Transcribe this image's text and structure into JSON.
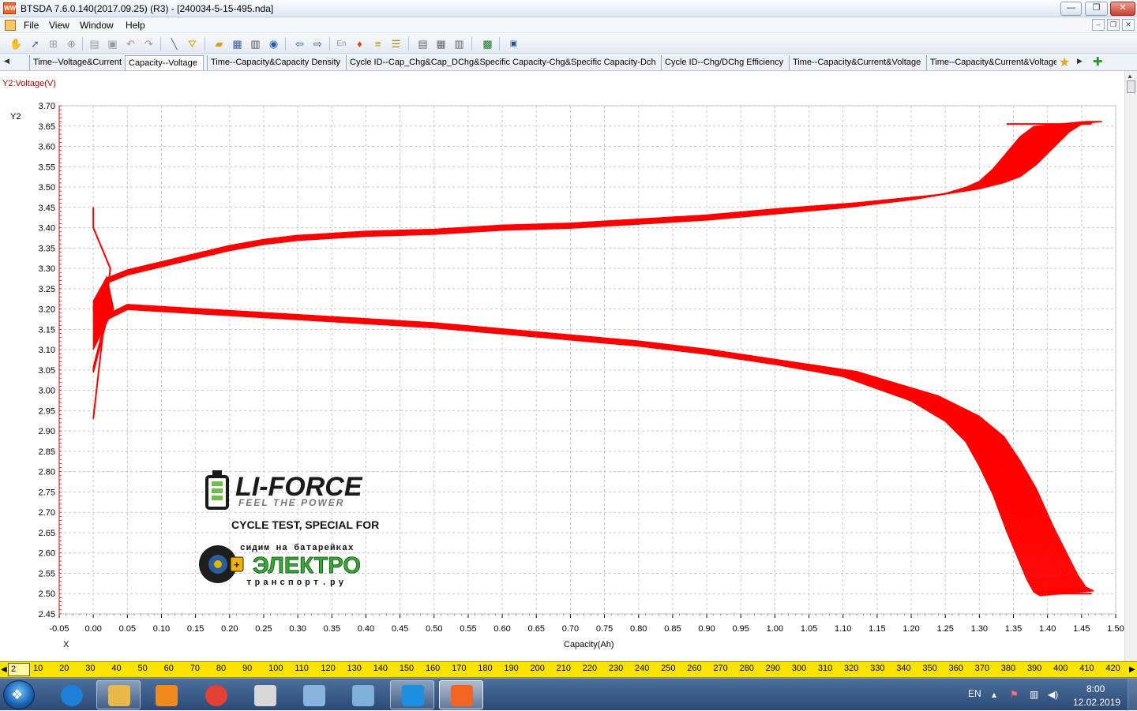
{
  "window": {
    "title": "BTSDA 7.6.0.140(2017.09.25) (R3) - [240034-5-15-495.nda]",
    "app_icon_label": "WW",
    "min_label": "—",
    "max_label": "❐",
    "close_label": "✕"
  },
  "menu": [
    "File",
    "View",
    "Window",
    "Help"
  ],
  "mdi": {
    "min": "–",
    "restore": "❐",
    "close": "✕"
  },
  "tabs": [
    {
      "label": "Time--Voltage&Current",
      "active": false
    },
    {
      "label": "Capacity--Voltage",
      "active": true
    },
    {
      "label": "Time--Capacity&Capacity Density",
      "active": false
    },
    {
      "label": "Cycle ID--Cap_Chg&Cap_DChg&Specific Capacity-Chg&Specific Capacity-Dchg",
      "active": false
    },
    {
      "label": "Cycle ID--Chg/DChg Efficiency",
      "active": false
    },
    {
      "label": "Time--Capacity&Current&Voltage",
      "active": false
    },
    {
      "label": "Time--Capacity&Current&Voltage",
      "active": false
    }
  ],
  "chart_data": {
    "type": "line",
    "y2_series_label": "Y2:Voltage(V)",
    "ylabel": "Y2",
    "xaxis_marker": "X",
    "xlabel": "Capacity(Ah)",
    "xlim": [
      -0.05,
      1.5
    ],
    "ylim": [
      2.45,
      3.7
    ],
    "x_ticks": [
      -0.05,
      0.0,
      0.05,
      0.1,
      0.15,
      0.2,
      0.25,
      0.3,
      0.35,
      0.4,
      0.45,
      0.5,
      0.55,
      0.6,
      0.65,
      0.7,
      0.75,
      0.8,
      0.85,
      0.9,
      0.95,
      1.0,
      1.05,
      1.1,
      1.15,
      1.2,
      1.25,
      1.3,
      1.35,
      1.4,
      1.45,
      1.5
    ],
    "y_ticks": [
      2.45,
      2.5,
      2.55,
      2.6,
      2.65,
      2.7,
      2.75,
      2.8,
      2.85,
      2.9,
      2.95,
      3.0,
      3.05,
      3.1,
      3.15,
      3.2,
      3.25,
      3.3,
      3.35,
      3.4,
      3.45,
      3.5,
      3.55,
      3.6,
      3.65,
      3.7
    ],
    "grid": true,
    "series_color": "#ff0000",
    "charge_curve": {
      "x": [
        0.0,
        0.02,
        0.05,
        0.1,
        0.15,
        0.2,
        0.25,
        0.3,
        0.4,
        0.5,
        0.6,
        0.7,
        0.8,
        0.9,
        1.0,
        1.1,
        1.2,
        1.25,
        1.28,
        1.3,
        1.32,
        1.34,
        1.36,
        1.38,
        1.4
      ],
      "y": [
        3.2,
        3.27,
        3.29,
        3.31,
        3.33,
        3.35,
        3.365,
        3.375,
        3.385,
        3.39,
        3.4,
        3.405,
        3.415,
        3.425,
        3.44,
        3.455,
        3.475,
        3.49,
        3.505,
        3.52,
        3.55,
        3.59,
        3.63,
        3.655,
        3.655
      ],
      "x_spread": 0.08
    },
    "discharge_curve": {
      "x": [
        0.0,
        0.02,
        0.05,
        0.1,
        0.2,
        0.3,
        0.4,
        0.5,
        0.6,
        0.7,
        0.8,
        0.9,
        1.0,
        1.05,
        1.1,
        1.15,
        1.2,
        1.25,
        1.28,
        1.3,
        1.32,
        1.34,
        1.36,
        1.37,
        1.38,
        1.39
      ],
      "y": [
        3.05,
        3.18,
        3.205,
        3.2,
        3.19,
        3.18,
        3.17,
        3.16,
        3.145,
        3.13,
        3.115,
        3.095,
        3.07,
        3.055,
        3.04,
        3.01,
        2.98,
        2.93,
        2.88,
        2.82,
        2.75,
        2.66,
        2.58,
        2.54,
        2.51,
        2.5
      ],
      "x_spread": 0.08
    },
    "initial_spike": {
      "x": [
        0.0,
        0.0,
        0.025,
        0.0
      ],
      "y": [
        3.45,
        3.4,
        3.3,
        2.93
      ]
    }
  },
  "watermark": {
    "brand": "LI-FORCE",
    "tagline": "FEEL THE POWER",
    "cycle_text": "CYCLE TEST, SPECIAL FOR",
    "partner_top": "сидим на батарейках",
    "partner_main": "ЭЛЕКТРО",
    "partner_bottom": "транспорт.ру"
  },
  "ruler": {
    "start_value": "2",
    "ticks": [
      10,
      20,
      30,
      40,
      50,
      60,
      70,
      80,
      90,
      100,
      110,
      120,
      130,
      140,
      150,
      160,
      170,
      180,
      190,
      200,
      210,
      220,
      230,
      240,
      250,
      260,
      270,
      280,
      290,
      300,
      310,
      320,
      330,
      340,
      350,
      360,
      370,
      380,
      390,
      400,
      410,
      420
    ]
  },
  "taskbar": {
    "apps": [
      {
        "name": "internet-explorer-icon",
        "color": "#1e7fd6",
        "state": ""
      },
      {
        "name": "file-explorer-icon",
        "color": "#e9b84a",
        "state": "run"
      },
      {
        "name": "media-player-icon",
        "color": "#f08a1c",
        "state": ""
      },
      {
        "name": "chrome-icon",
        "color": "#e34133",
        "state": ""
      },
      {
        "name": "package-box-icon",
        "color": "#d8d8d8",
        "state": ""
      },
      {
        "name": "calculator-icon",
        "color": "#8ab4e0",
        "state": ""
      },
      {
        "name": "paint-icon",
        "color": "#7fb0dc",
        "state": ""
      },
      {
        "name": "btsda-monitor-icon",
        "color": "#1d8fe0",
        "state": "run"
      },
      {
        "name": "btsda-analyzer-icon",
        "color": "#f26522",
        "state": "act"
      }
    ],
    "lang": "EN",
    "time": "8:00",
    "date": "12.02.2019"
  }
}
